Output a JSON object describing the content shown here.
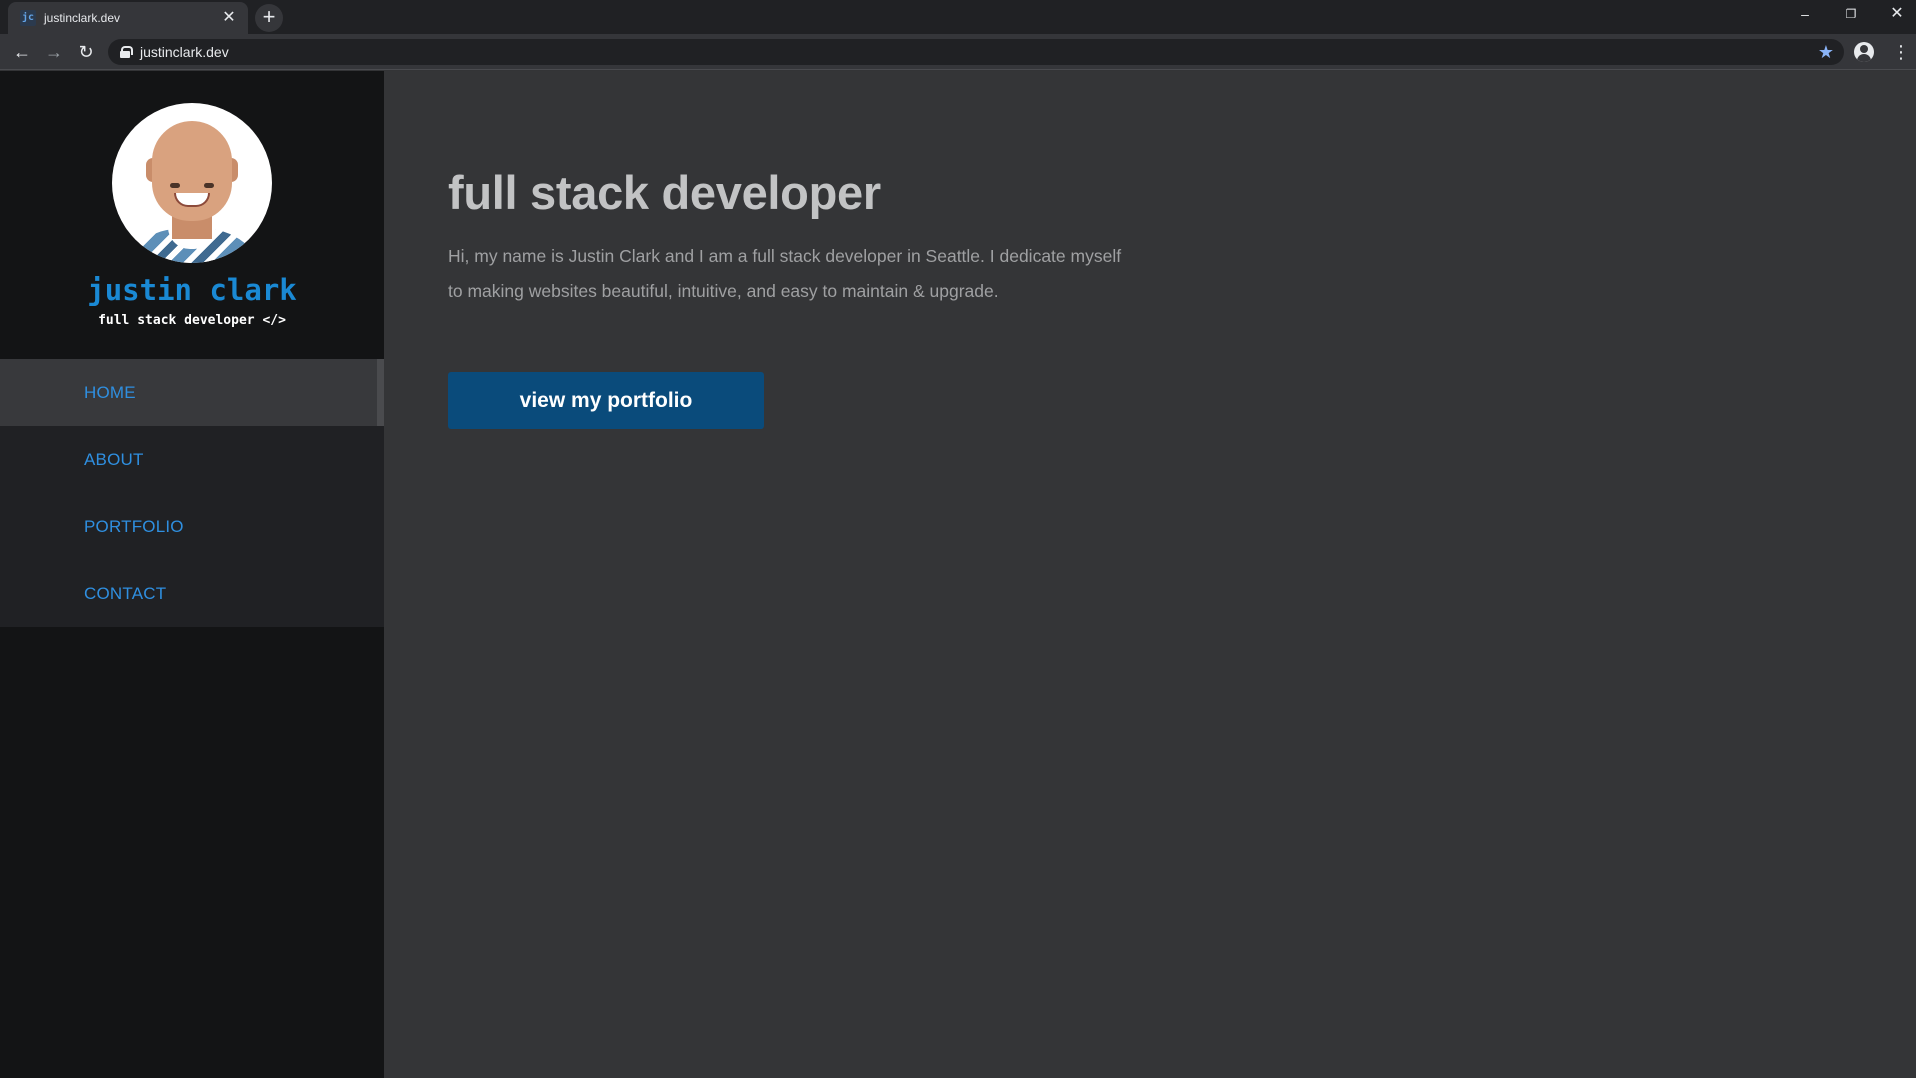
{
  "browser": {
    "tab_title": "justinclark.dev",
    "favicon_text": "jc",
    "new_tab_label": "+",
    "close_tab_label": "✕",
    "url": "justinclark.dev",
    "icons": [
      "back-icon",
      "forward-icon",
      "reload-icon",
      "lock-icon",
      "star-icon",
      "profile-icon",
      "menu-icon",
      "minimize-icon",
      "restore-icon",
      "close-window-icon"
    ]
  },
  "sidebar": {
    "name": "justin clark",
    "tagline": "full stack developer </>",
    "nav": [
      {
        "label": "HOME",
        "active": true
      },
      {
        "label": "ABOUT",
        "active": false
      },
      {
        "label": "PORTFOLIO",
        "active": false
      },
      {
        "label": "CONTACT",
        "active": false
      }
    ]
  },
  "main": {
    "headline": "full stack developer",
    "intro_line1": "Hi, my name is Justin Clark and I am a full stack developer in Seattle. I dedicate myself",
    "intro_line2": "to making websites beautiful, intuitive, and easy to maintain & upgrade.",
    "cta_label": "view my portfolio"
  },
  "colors": {
    "accent": "#1a89d4",
    "nav_link": "#2f8fe0",
    "button_bg": "#0a4b7b",
    "sidebar_bg": "#131415",
    "main_bg": "#343537"
  }
}
